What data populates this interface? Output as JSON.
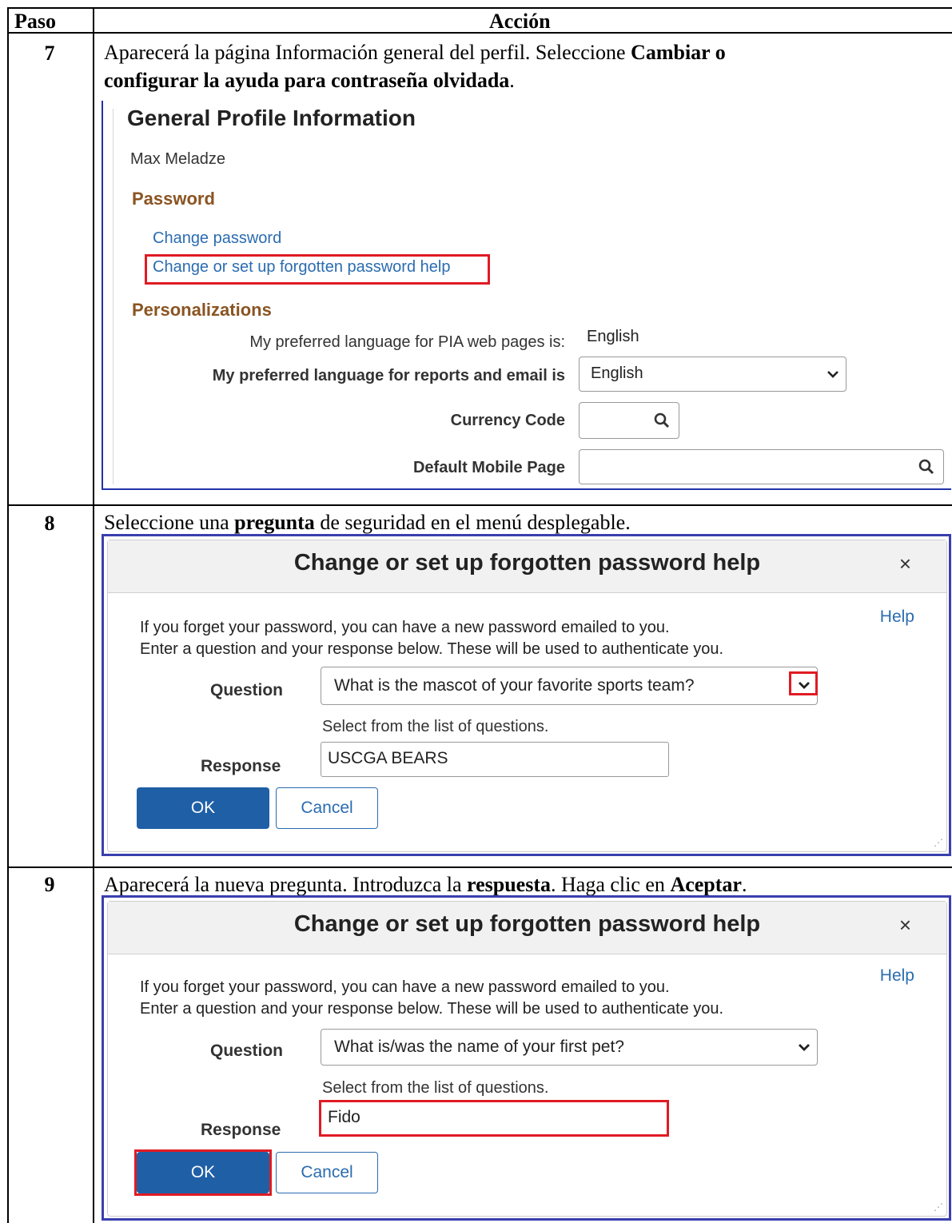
{
  "header": {
    "step_col": "Paso",
    "action_col": "Acción"
  },
  "steps": [
    {
      "num": "7",
      "line1_pre": "Aparecerá la página Información general del perfil.  Seleccione ",
      "line1_bold": "Cambiar o",
      "line2_bold": "configurar la ayuda para contraseña olvidada",
      "line2_post": "."
    },
    {
      "num": "8",
      "pre": "Seleccione una ",
      "bold": "pregunta",
      "post": " de seguridad en el menú desplegable."
    },
    {
      "num": "9",
      "pre": "Aparecerá la nueva pregunta. Introduzca la ",
      "bold1": "respuesta",
      "mid": ". Haga clic en ",
      "bold2": "Aceptar",
      "post": "."
    }
  ],
  "profile": {
    "title": "General Profile Information",
    "user_name": "Max Meladze",
    "password_section": "Password",
    "change_password": "Change password",
    "forgot_help_link": "Change or set up forgotten password help",
    "personalizations_section": "Personalizations",
    "pia_lang_label": "My preferred language for PIA web pages is:",
    "pia_lang_value": "English",
    "report_lang_label": "My preferred language for reports and email is",
    "report_lang_value": "English",
    "currency_label": "Currency Code",
    "currency_value": "",
    "mobile_label": "Default Mobile Page",
    "mobile_value": ""
  },
  "dialog1": {
    "title": "Change or set up forgotten password help",
    "close": "×",
    "help": "Help",
    "text1": "If you forget your password, you can have a new password emailed to you.",
    "text2": "Enter a question and your response below. These will be used to authenticate you.",
    "question_label": "Question",
    "question_value": "What is the mascot of your favorite sports team?",
    "hint": "Select from the list of questions.",
    "response_label": "Response",
    "response_value": "USCGA BEARS",
    "ok": "OK",
    "cancel": "Cancel"
  },
  "dialog2": {
    "title": "Change or set up forgotten password help",
    "close": "×",
    "help": "Help",
    "text1": "If you forget your password, you can have a new password emailed to you.",
    "text2": "Enter a question and your response below. These will be used to authenticate you.",
    "question_label": "Question",
    "question_value": "What is/was the name of your first pet?",
    "hint": "Select from the list of questions.",
    "response_label": "Response",
    "response_value": "Fido",
    "ok": "OK",
    "cancel": "Cancel"
  },
  "colors": {
    "highlight": "#e01b24",
    "link": "#2b6cb0",
    "section_heading": "#8a5422",
    "ok_button": "#1f5fa6"
  }
}
